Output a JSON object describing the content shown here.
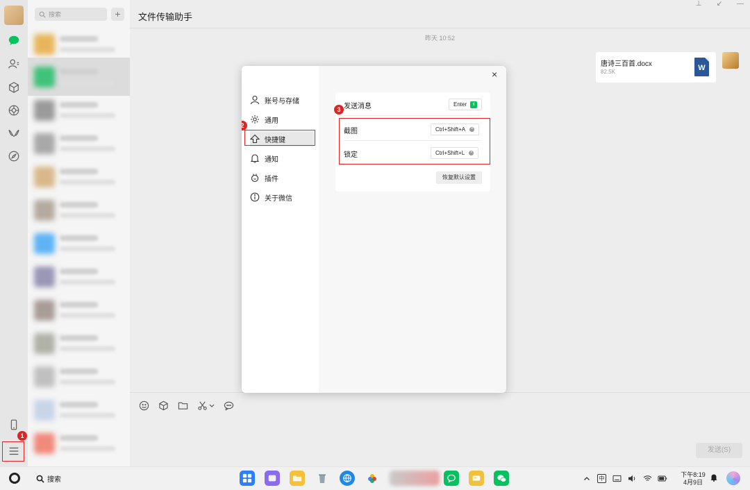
{
  "app": {
    "title": "文件传输助手"
  },
  "convlist": {
    "search_placeholder": "搜索",
    "add_label": "+"
  },
  "chat": {
    "timestamp": "昨天 10:52",
    "file": {
      "name": "唐诗三百首.docx",
      "size": "82.5K",
      "icon": "W"
    },
    "send_label": "发送(S)"
  },
  "settings": {
    "close_label": "×",
    "nav": [
      {
        "label": "账号与存储",
        "icon": "person-icon"
      },
      {
        "label": "通用",
        "icon": "gear-icon"
      },
      {
        "label": "快捷键",
        "icon": "shortcut-icon"
      },
      {
        "label": "通知",
        "icon": "bell-icon"
      },
      {
        "label": "插件",
        "icon": "plugin-icon"
      },
      {
        "label": "关于微信",
        "icon": "info-icon"
      }
    ],
    "selected_nav": "快捷键",
    "shortcuts": {
      "send": {
        "label": "发送消息",
        "key": "Enter"
      },
      "screenshot": {
        "label": "截图",
        "key": "Ctrl+Shift+A"
      },
      "lock": {
        "label": "锁定",
        "key": "Ctrl+Shift+L"
      }
    },
    "restore_label": "恢复默认设置"
  },
  "steps": {
    "one": "1",
    "two": "2",
    "three": "3"
  },
  "taskbar": {
    "search_label": "搜索",
    "input_method": "中",
    "time": "下午8:19",
    "date": "4月9日"
  },
  "colors": {
    "accent_green": "#07c160",
    "highlight_red": "#e02424",
    "word_blue": "#2b5797"
  }
}
